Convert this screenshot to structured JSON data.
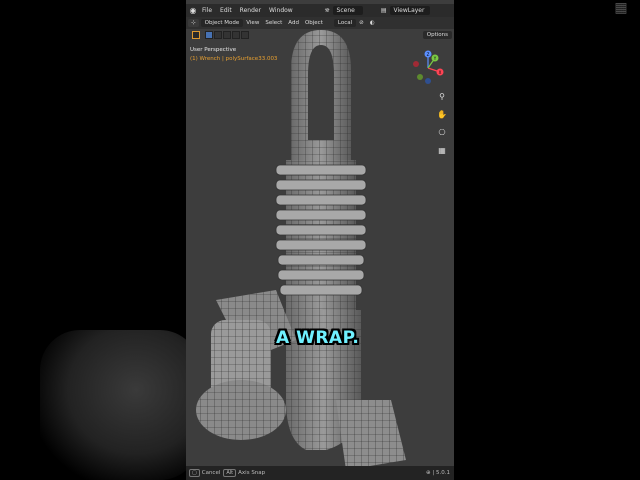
{
  "topbar": {
    "menus": [
      "File",
      "Edit",
      "Render",
      "Window"
    ],
    "scene": "Scene",
    "view_layer": "ViewLayer"
  },
  "header": {
    "mode": "Object Mode",
    "menus": [
      "View",
      "Select",
      "Add",
      "Object"
    ],
    "transform": "Local"
  },
  "toolbar": {
    "options": "Options"
  },
  "viewport": {
    "perspective": "User Perspective",
    "object_info": "(1) Wrench | polySurface33.003"
  },
  "gizmo": {
    "x": "X",
    "y": "Y",
    "z": "Z"
  },
  "caption": "A WRAP.",
  "statusbar": {
    "cancel": "Cancel",
    "alt_key": "Alt",
    "axis_snap": "Axis Snap",
    "version": "5.0.1"
  },
  "colors": {
    "accent": "#4772b3",
    "caption": "#6ff0ff",
    "object_text": "#e8a030"
  }
}
